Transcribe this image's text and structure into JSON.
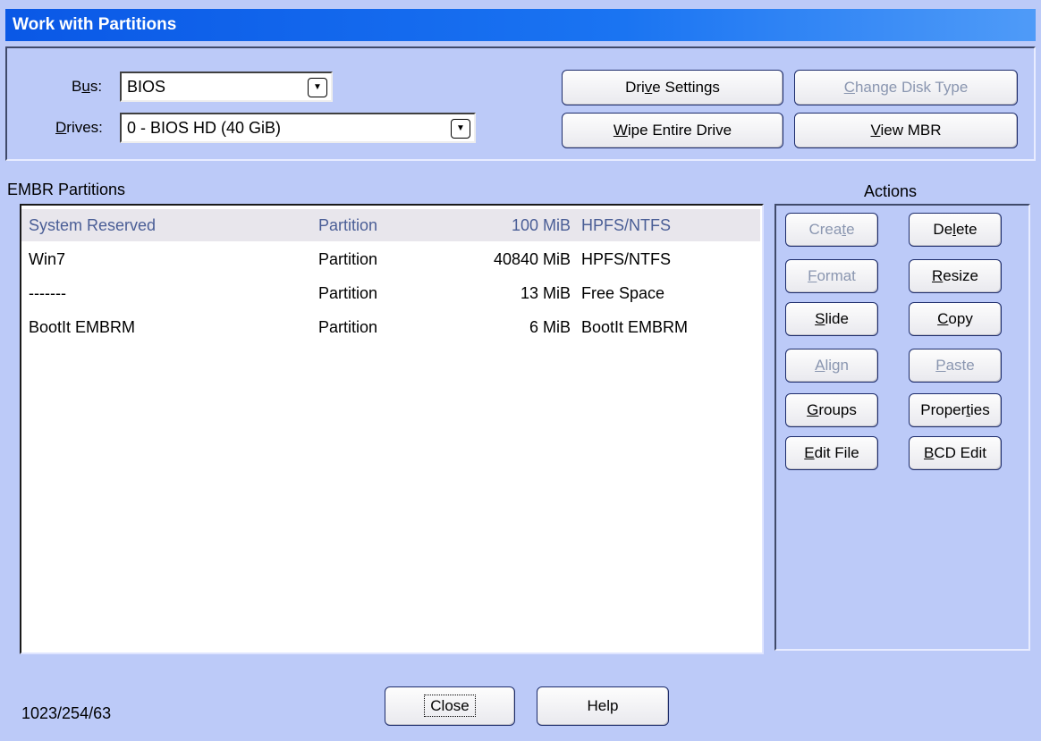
{
  "window": {
    "title": "Work with Partitions"
  },
  "drive": {
    "bus_label_before": "B",
    "bus_label_ul": "u",
    "bus_label_after": "s:",
    "bus_value": "BIOS",
    "drives_label_ul": "D",
    "drives_label_after": "rives:",
    "drives_value": "0 - BIOS HD (40 GiB)"
  },
  "top_buttons": {
    "drive_settings_before": "Dri",
    "drive_settings_ul": "v",
    "drive_settings_after": "e Settings",
    "change_disk_ul": "C",
    "change_disk_after": "hange Disk Type",
    "wipe_ul": "W",
    "wipe_after": "ipe Entire Drive",
    "view_mbr_ul": "V",
    "view_mbr_after": "iew MBR"
  },
  "partitions": {
    "heading": "EMBR Partitions",
    "rows": [
      {
        "name": "System Reserved",
        "type": "Partition",
        "size": "100 MiB",
        "fs": "HPFS/NTFS"
      },
      {
        "name": "Win7",
        "type": "Partition",
        "size": "40840 MiB",
        "fs": "HPFS/NTFS"
      },
      {
        "name": "-------",
        "type": "Partition",
        "size": "13 MiB",
        "fs": "Free Space"
      },
      {
        "name": "BootIt EMBRM",
        "type": "Partition",
        "size": "6 MiB",
        "fs": "BootIt EMBRM"
      }
    ]
  },
  "actions": {
    "heading": "Actions",
    "create_before": "Crea",
    "create_ul": "t",
    "create_after": "e",
    "delete_before": "De",
    "delete_ul": "l",
    "delete_after": "ete",
    "format_ul": "F",
    "format_after": "ormat",
    "resize_ul": "R",
    "resize_after": "esize",
    "slide_ul": "S",
    "slide_after": "lide",
    "copy_ul": "C",
    "copy_after": "opy",
    "align_ul": "A",
    "align_after": "lign",
    "paste_ul": "P",
    "paste_after": "aste",
    "groups_ul": "G",
    "groups_after": "roups",
    "properties_before": "Proper",
    "properties_ul": "t",
    "properties_after": "ies",
    "editfile_ul": "E",
    "editfile_after": "dit File",
    "bcdedit_ul": "B",
    "bcdedit_after": "CD Edit"
  },
  "footer": {
    "geometry": "1023/254/63",
    "close_label": "Close",
    "help_label": "Help"
  }
}
